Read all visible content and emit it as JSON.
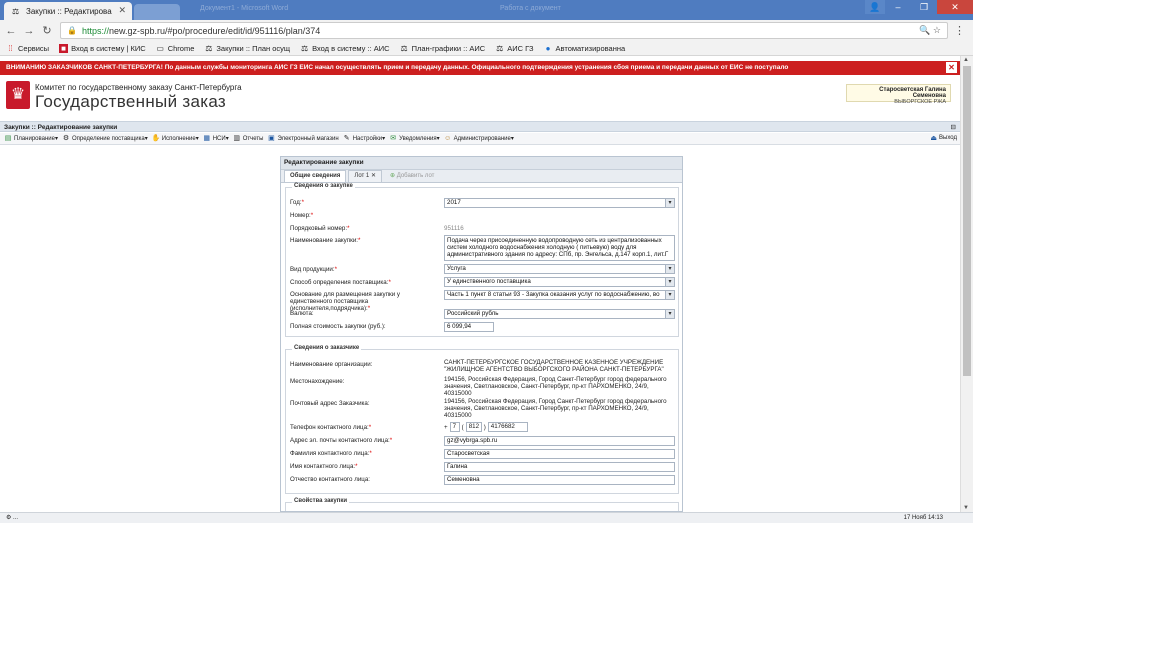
{
  "browser": {
    "tab_title": "Закупки :: Редактирова",
    "ghost_tabs": [
      "Документ1 - Microsoft Word",
      "Работа с документ"
    ],
    "url_secure": "https://",
    "url_host": "new.gz-spb.ru",
    "url_path": "/#po/procedure/edit/id/951116/plan/374",
    "bookmarks": [
      {
        "label": "Сервисы",
        "icon": "apps-icon"
      },
      {
        "label": "Вход в систему | КИС",
        "icon": "site-icon"
      },
      {
        "label": "Chrome",
        "icon": "page-icon"
      },
      {
        "label": "Закупки :: План осущ",
        "icon": "scales-icon"
      },
      {
        "label": "Вход в систему :: АИС",
        "icon": "scales-icon"
      },
      {
        "label": "План-графики :: АИС",
        "icon": "scales-icon"
      },
      {
        "label": "АИС ГЗ",
        "icon": "scales-icon"
      },
      {
        "label": "Автоматизированна",
        "icon": "globe-icon"
      }
    ]
  },
  "alert": {
    "text": "ВНИМАНИЮ ЗАКАЗЧИКОВ САНКТ-ПЕТЕРБУРГА! По данным службы мониторинга АИС ГЗ ЕИС начал осуществлять прием и передачу данных. Официального подтверждения устранения сбоя приема и передачи данных от ЕИС не поступало"
  },
  "header": {
    "org_small": "Комитет по государственному заказу Санкт-Петербурга",
    "org_big": "Государственный заказ",
    "user_name": "Старосветская Галина Семеновна",
    "user_dept": "ВЫБОРГСКОЕ РЖА"
  },
  "module_title": "Закупки :: Редактирование закупки",
  "menu": {
    "items": [
      "Планирование",
      "Определение поставщика",
      "Исполнение",
      "НСИ",
      "Отчеты",
      "Электронный магазин",
      "Настройки",
      "Уведомления",
      "Администрирование"
    ],
    "exit": "Выход"
  },
  "dialog": {
    "title": "Редактирование закупки",
    "tabs": {
      "general": "Общие сведения",
      "lot": "Лот 1",
      "add_lot": "Добавить лот"
    },
    "procurement": {
      "legend": "Сведения о закупке",
      "year_label": "Год:",
      "year_value": "2017",
      "number_label": "Номер:",
      "order_label": "Порядковый номер:",
      "order_value": "951116",
      "name_label": "Наименование закупки:",
      "name_value": "Подача через присоединенную водопроводную сеть из централизованных систем холодного водоснабжения холодную       ( питьевую) воду для административного здания по адресу: СПб, пр. Энгельса, д.147 корп.1, лит.Г",
      "product_label": "Вид продукции:",
      "product_value": "Услуга",
      "method_label": "Способ определения поставщика:",
      "method_value": "У единственного поставщика",
      "basis_label": "Основание для размещения закупки у единственного поставщика (исполнителя,подрядчика):",
      "basis_value": "Часть 1 пункт 8 статьи 93 - Закупка оказания услуг по водоснабжению, во",
      "currency_label": "Валюта:",
      "currency_value": "Российский рубль",
      "cost_label": "Полная стоимость закупки (руб.):",
      "cost_value": "6 099,94"
    },
    "customer": {
      "legend": "Сведения о заказчике",
      "org_label": "Наименование организации:",
      "org_value": "САНКТ-ПЕТЕРБУРГСКОЕ ГОСУДАРСТВЕННОЕ КАЗЕННОЕ УЧРЕЖДЕНИЕ \"ЖИЛИЩНОЕ АГЕНТСТВО ВЫБОРГСКОГО РАЙОНА САНКТ-ПЕТЕРБУРГА\"",
      "location_label": "Местонахождение:",
      "location_value": "194156, Российская Федерация, Город Санкт-Петербург город федерального значения, Светлановское, Санкт-Петербург, пр-кт ПАРХОМЕНКО, 24/9, 40315000",
      "postal_label": "Почтовый адрес Заказчика:",
      "postal_value": "194156, Российская Федерация, Город Санкт-Петербург город федерального значения, Светлановское, Санкт-Петербург, пр-кт ПАРХОМЕНКО, 24/9, 40315000",
      "phone_label": "Телефон контактного лица:",
      "phone_plus": "+",
      "phone_country": "7",
      "phone_code": "812",
      "phone_number": "4176682",
      "email_label": "Адрес эл. почты контактного лица:",
      "email_value": "gz@vybrga.spb.ru",
      "surname_label": "Фамилия контактного лица:",
      "surname_value": "Старосветская",
      "firstname_label": "Имя контактного лица:",
      "firstname_value": "Галина",
      "patronymic_label": "Отчество контактного лица:",
      "patronymic_value": "Семеновна"
    },
    "properties": {
      "legend": "Свойства закупки"
    }
  },
  "status": {
    "left": "⚙ ...",
    "right": "17 Нояб 14:13"
  },
  "colors": {
    "alert_bg": "#cc1f1f",
    "chrome_tabs": "#4f7cc0",
    "required": "#dd0000"
  }
}
